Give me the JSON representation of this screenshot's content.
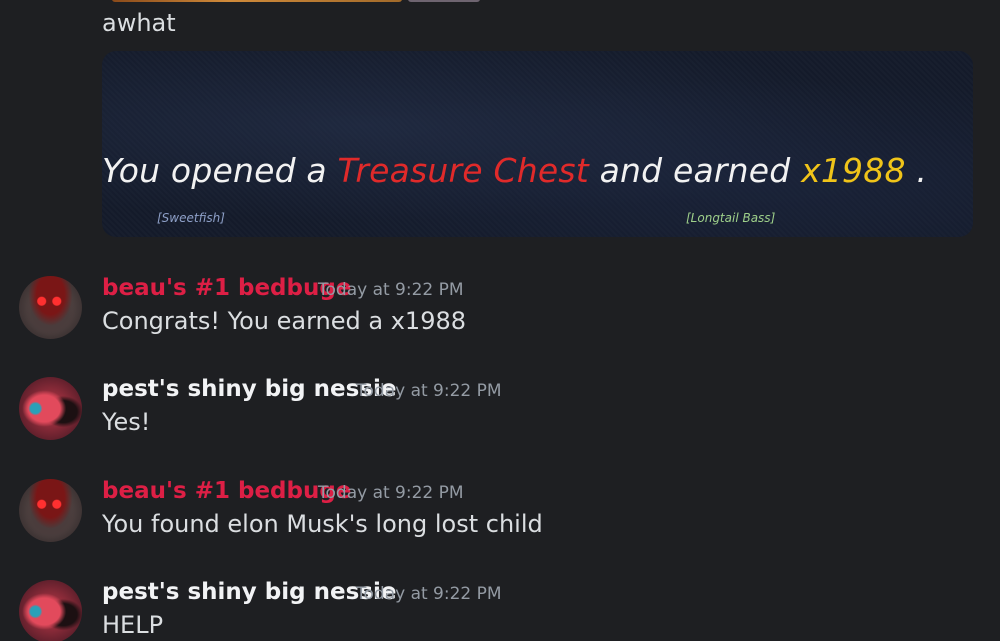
{
  "prev_message": {
    "text": "awhat",
    "embed": {
      "line_prefix": "You opened a ",
      "item": "Treasure Chest",
      "line_mid": " and earned ",
      "amount": "x1988",
      "line_suffix": " .",
      "tag_left": "[Sweetfish]",
      "tag_right": "[Longtail Bass]"
    }
  },
  "messages": [
    {
      "author": "beau's #1 bedbuge",
      "timestamp": "Today at 9:22 PM",
      "text": "Congrats! You earned a x1988"
    },
    {
      "author": "pest's shiny big nessie",
      "timestamp": "Today at 9:22 PM",
      "text": "Yes!"
    },
    {
      "author": "beau's #1 bedbuge",
      "timestamp": "Today at 9:22 PM",
      "text": "You found elon Musk's long lost child"
    },
    {
      "author": "pest's shiny big nessie",
      "timestamp": "Today at 9:22 PM",
      "text": "HELP"
    }
  ],
  "colors": {
    "background": "#1e1f22",
    "author_red": "#dd1f45",
    "author_white": "#f2f3f5",
    "timestamp": "#949ba4",
    "message_text": "#dbdee1",
    "embed_red": "#e02a2a",
    "embed_gold": "#f0c419"
  },
  "icons": {
    "avatar_1": "avatar-hooded-red-eyes",
    "avatar_2": "avatar-red-creature"
  }
}
